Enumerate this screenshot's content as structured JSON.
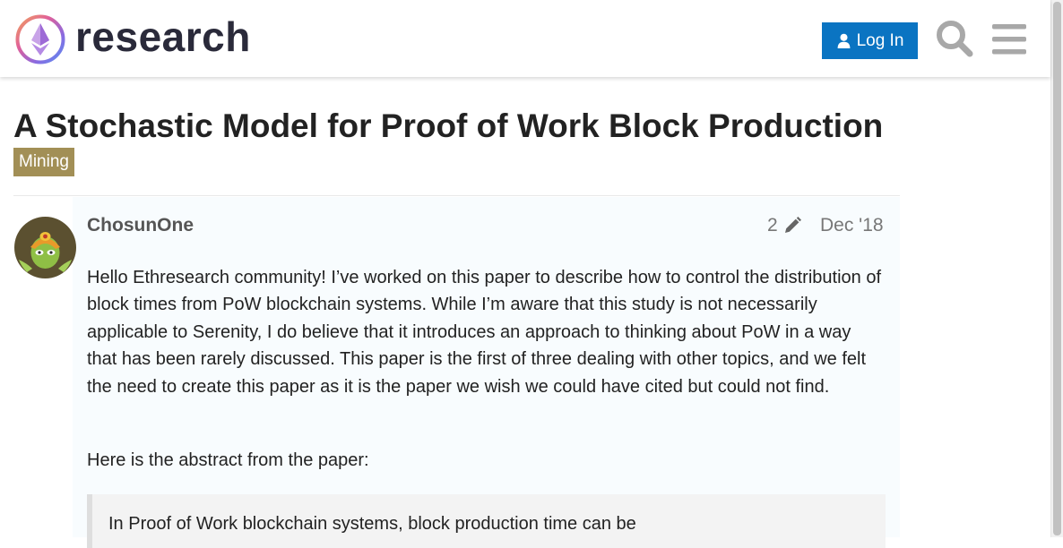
{
  "header": {
    "site_name": "research",
    "login_label": "Log In",
    "icons": {
      "logo": "ethresearch-logo",
      "login": "user-icon",
      "search": "search-icon",
      "menu": "hamburger-menu-icon"
    },
    "colors": {
      "login_button": "#0a74c2",
      "header_icons": "#a8a8a8"
    }
  },
  "topic": {
    "title": "A Stochastic Model for Proof of Work Block Production",
    "category": "Mining",
    "category_color": "#a28f56"
  },
  "post": {
    "username": "ChosunOne",
    "edit_count": "2",
    "edit_icon": "pencil-icon",
    "date": "Dec '18",
    "paragraphs": [
      "Hello Ethresearch community! I’ve worked on this paper to describe how to control the distribution of block times from PoW blockchain systems. While I’m aware that this study is not necessarily applicable to Serenity, I do believe that it introduces an approach to thinking about PoW in a way that has been rarely discussed. This paper is the first of three dealing with other topics, and we felt the need to create this paper as it is the paper we wish we could have cited but could not find.",
      "Here is the abstract from the paper:"
    ],
    "quote_text": "In Proof of Work blockchain systems, block production time can be"
  }
}
